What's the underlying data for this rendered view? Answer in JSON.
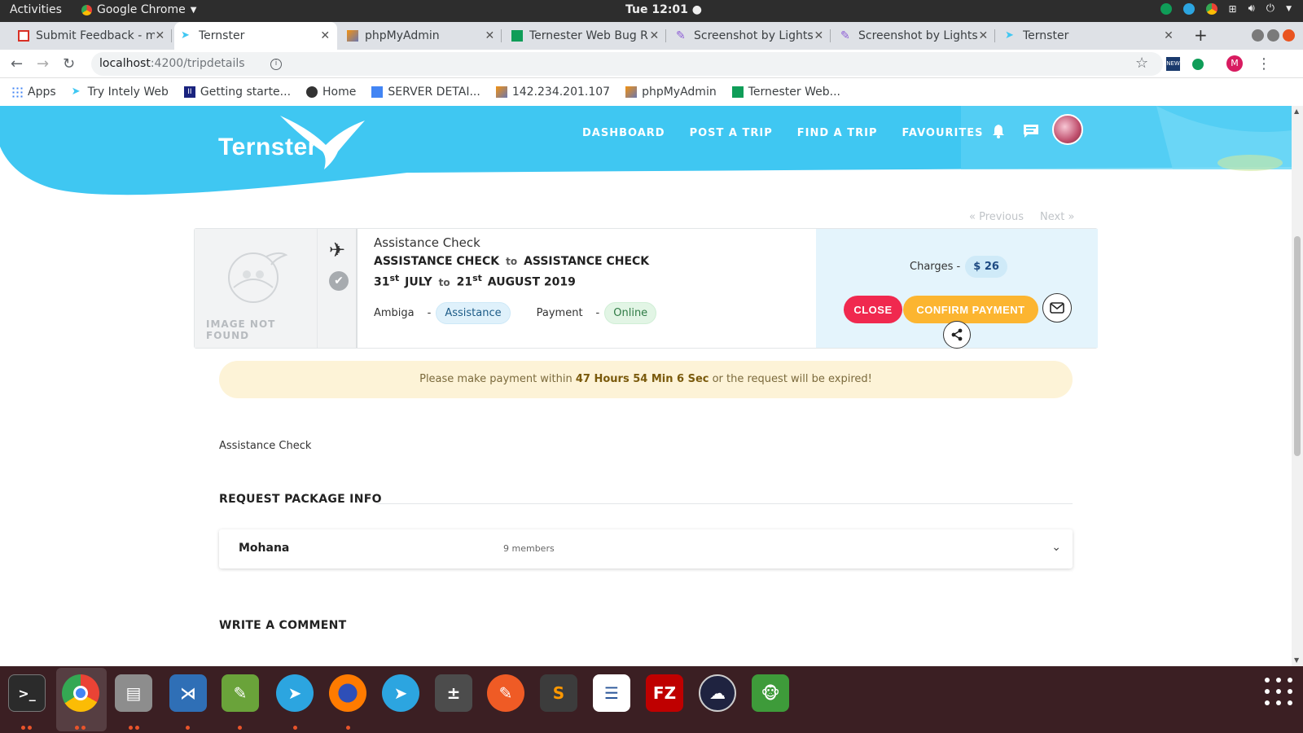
{
  "system": {
    "activities": "Activities",
    "app_name": "Google Chrome",
    "clock": "Tue 12:01 ●"
  },
  "tabs": [
    {
      "title": "Submit Feedback - m",
      "icon": "gmail-icon"
    },
    {
      "title": "Ternster",
      "icon": "ternster-icon",
      "active": true
    },
    {
      "title": "phpMyAdmin",
      "icon": "phpmyadmin-icon"
    },
    {
      "title": "Ternester Web Bug R",
      "icon": "sheets-icon"
    },
    {
      "title": "Screenshot by Lights",
      "icon": "lightshot-icon"
    },
    {
      "title": "Screenshot by Lights",
      "icon": "lightshot-icon"
    },
    {
      "title": "Ternster",
      "icon": "ternster-icon"
    }
  ],
  "address": {
    "host": "localhost",
    "path": ":4200/tripdetails"
  },
  "bookmarks": [
    {
      "label": "Apps",
      "icon": "apps-grid-icon"
    },
    {
      "label": "Try Intely Web",
      "icon": "ternster-icon"
    },
    {
      "label": "Getting starte...",
      "icon": "ii-icon"
    },
    {
      "label": "Home",
      "icon": "github-icon"
    },
    {
      "label": "SERVER DETAI...",
      "icon": "docs-icon"
    },
    {
      "label": "142.234.201.107",
      "icon": "phpmyadmin-icon"
    },
    {
      "label": "phpMyAdmin",
      "icon": "phpmyadmin-icon"
    },
    {
      "label": "Ternester Web...",
      "icon": "sheets-icon"
    }
  ],
  "site": {
    "logo": "Ternster",
    "nav": [
      "DASHBOARD",
      "POST A TRIP",
      "FIND A TRIP",
      "FAVOURITES"
    ],
    "pager": {
      "previous": "«  Previous",
      "next": "Next  »"
    }
  },
  "trip": {
    "image_missing_label": "IMAGE NOT FOUND",
    "title": "Assistance Check",
    "from": "ASSISTANCE CHECK",
    "to_word": "to",
    "destination": "ASSISTANCE CHECK",
    "start_day": "31",
    "start_suffix": "st",
    "start_month": "JULY",
    "end_day": "21",
    "end_suffix": "st",
    "end_month": "AUGUST 2019",
    "user": "Ambiga",
    "dash": "-",
    "type": "Assistance",
    "payment_label": "Payment",
    "payment_mode": "Online",
    "charges_label": "Charges -",
    "charges_amount": "$ 26",
    "close_label": "CLOSE",
    "confirm_label": "CONFIRM PAYMENT"
  },
  "alert": {
    "before": "Please make payment within ",
    "countdown": "47 Hours 54 Min 6 Sec",
    "after": " or the request will be expired!"
  },
  "description": "Assistance Check",
  "package": {
    "heading": "REQUEST PACKAGE INFO",
    "name": "Mohana",
    "members": "9 members"
  },
  "comment_heading": "WRITE A COMMENT",
  "colors": {
    "brand": "#3fc7f2",
    "close": "#f0294f",
    "confirm": "#fcb530"
  }
}
